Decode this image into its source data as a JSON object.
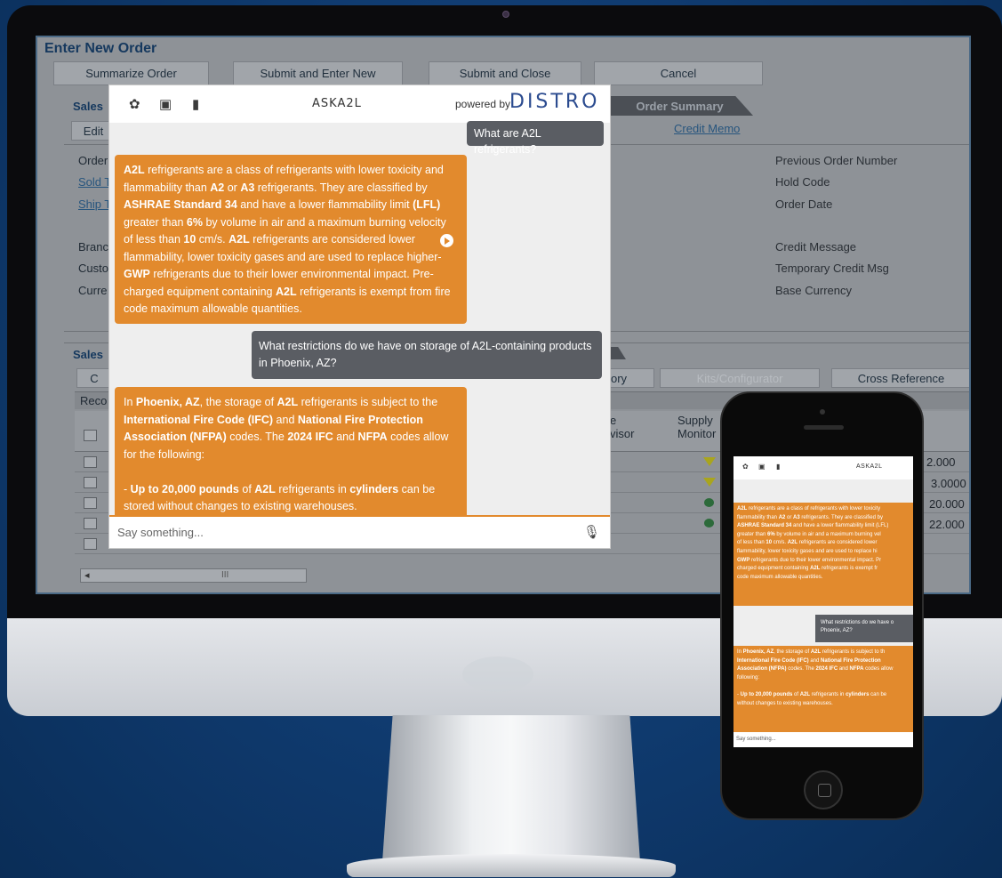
{
  "erp": {
    "title": "Enter New Order",
    "toolbar": [
      "Summarize Order",
      "Submit and Enter New",
      "Submit and Close",
      "Cancel"
    ],
    "sections": {
      "sales": "Sales",
      "sales2": "Sales",
      "order_summary": "Order Summary",
      "edit": "Edit",
      "credit_memo": "Credit Memo"
    },
    "left_labels": [
      "Order",
      "Sold T",
      "Ship T",
      "Branc",
      "Custo",
      "Curre"
    ],
    "right_labels": [
      "Previous Order Number",
      "Hold Code",
      "Order Date",
      "Credit Message",
      "Temporary Credit Msg",
      "Base Currency"
    ],
    "grid_buttons": {
      "c": "C",
      "ory": "ory",
      "kits": "Kits/Configurator",
      "cross_reference": "Cross Reference"
    },
    "grid_headers": {
      "reco": "Reco",
      "advisor": "e\nvisor",
      "supply_monitor": "Supply\nMonitor"
    },
    "scroll_label": "III",
    "values": [
      "2.000",
      "3.0000",
      "20.000",
      "22.000"
    ]
  },
  "chat": {
    "brand": "ASKA2L",
    "powered_by": "powered by",
    "provider": "DISTRO",
    "question1": "What are A2L refrigerants?",
    "question2": "What restrictions do we have on storage of A2L-containing products in Phoenix, AZ?",
    "input_placeholder": "Say something..."
  },
  "phone": {
    "brand": "ASKA2L",
    "placeholder": "Say something..."
  },
  "colors": {
    "bot_bubble": "#e28a2d",
    "user_bubble": "#5a5d63",
    "provider": "#2b4b8f"
  }
}
